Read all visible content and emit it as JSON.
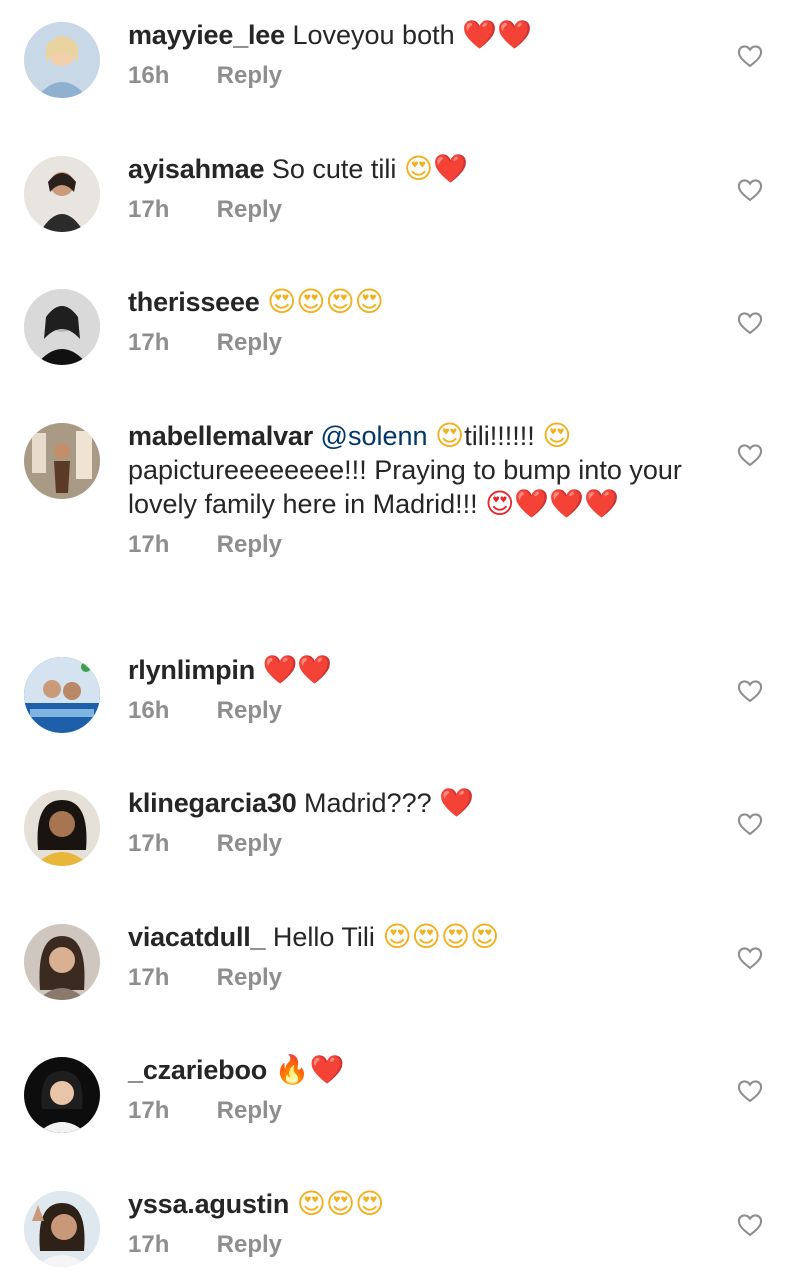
{
  "reply_label": "Reply",
  "comments": [
    {
      "username": "mayyiee_lee",
      "text": "Loveyou both",
      "emoji": "❤️❤️",
      "time": "16h"
    },
    {
      "username": "ayisahmae",
      "text": "So cute tili",
      "emoji": "😍❤️",
      "time": "17h"
    },
    {
      "username": "therisseee",
      "text": "",
      "emoji": "😍😍😍😍",
      "time": "17h"
    },
    {
      "username": "mabellemalvar",
      "mention": "@solenn",
      "text_a": "tili!!!!!!",
      "text_b": "papictureeeeeeee!!! Praying to bump into your lovely family here in Madrid!!!",
      "emoji_a": "😍",
      "emoji_b": "😍",
      "emoji_c": "😍❤️❤️❤️",
      "time": "17h"
    },
    {
      "username": "rlynlimpin",
      "text": "",
      "emoji": "❤️❤️",
      "time": "16h"
    },
    {
      "username": "klinegarcia30",
      "text": "Madrid???",
      "emoji": "❤️",
      "time": "17h"
    },
    {
      "username": "viacatdull_",
      "text": "Hello Tili",
      "emoji": "😍😍😍😍",
      "time": "17h"
    },
    {
      "username": "_czarieboo",
      "text": "",
      "emoji": "🔥❤️",
      "time": "17h"
    },
    {
      "username": "yssa.agustin",
      "text": "",
      "emoji": "😍😍😍",
      "time": "17h"
    }
  ],
  "colors": {
    "text": "#262626",
    "meta": "#8e8e8e",
    "mention": "#00376b",
    "heart_outline": "#8e8e8e"
  },
  "icons": {
    "like": "heart-outline-icon"
  }
}
